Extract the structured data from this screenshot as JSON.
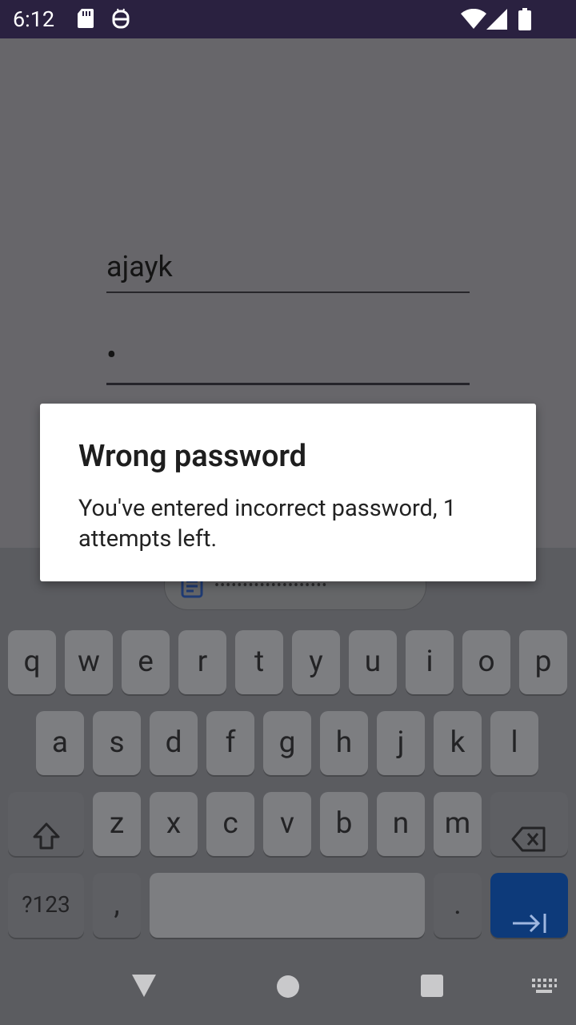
{
  "status_bar": {
    "time": "6:12"
  },
  "form": {
    "username_value": "ajayk",
    "password_value": "•"
  },
  "dialog": {
    "title": "Wrong password",
    "message": "You've entered incorrect password, 1 attempts left."
  },
  "keyboard": {
    "suggestion_masked": "••••••••••••••••••••",
    "row1": [
      "q",
      "w",
      "e",
      "r",
      "t",
      "y",
      "u",
      "i",
      "o",
      "p"
    ],
    "row2": [
      "a",
      "s",
      "d",
      "f",
      "g",
      "h",
      "j",
      "k",
      "l"
    ],
    "row3": [
      "z",
      "x",
      "c",
      "v",
      "b",
      "n",
      "m"
    ],
    "symbols_label": "?123",
    "comma_label": ",",
    "period_label": "."
  }
}
